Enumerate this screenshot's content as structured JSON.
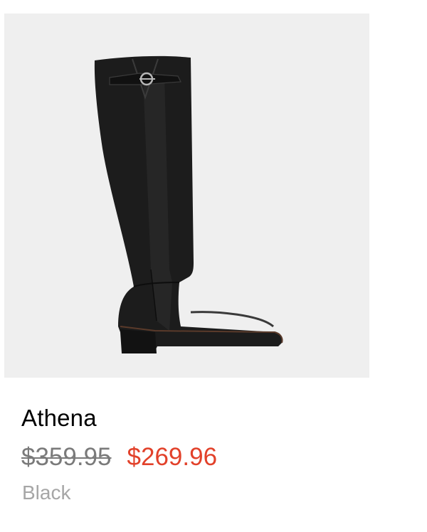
{
  "product": {
    "name": "Athena",
    "price_original": "$359.95",
    "price_sale": "$269.96",
    "color": "Black",
    "image_alt": "Athena knee-high black leather boot"
  },
  "colors": {
    "image_background": "#efefef",
    "sale_price": "#e2412a",
    "original_price": "#7a7a7a",
    "color_label": "#a6a6a6",
    "name": "#000000"
  }
}
